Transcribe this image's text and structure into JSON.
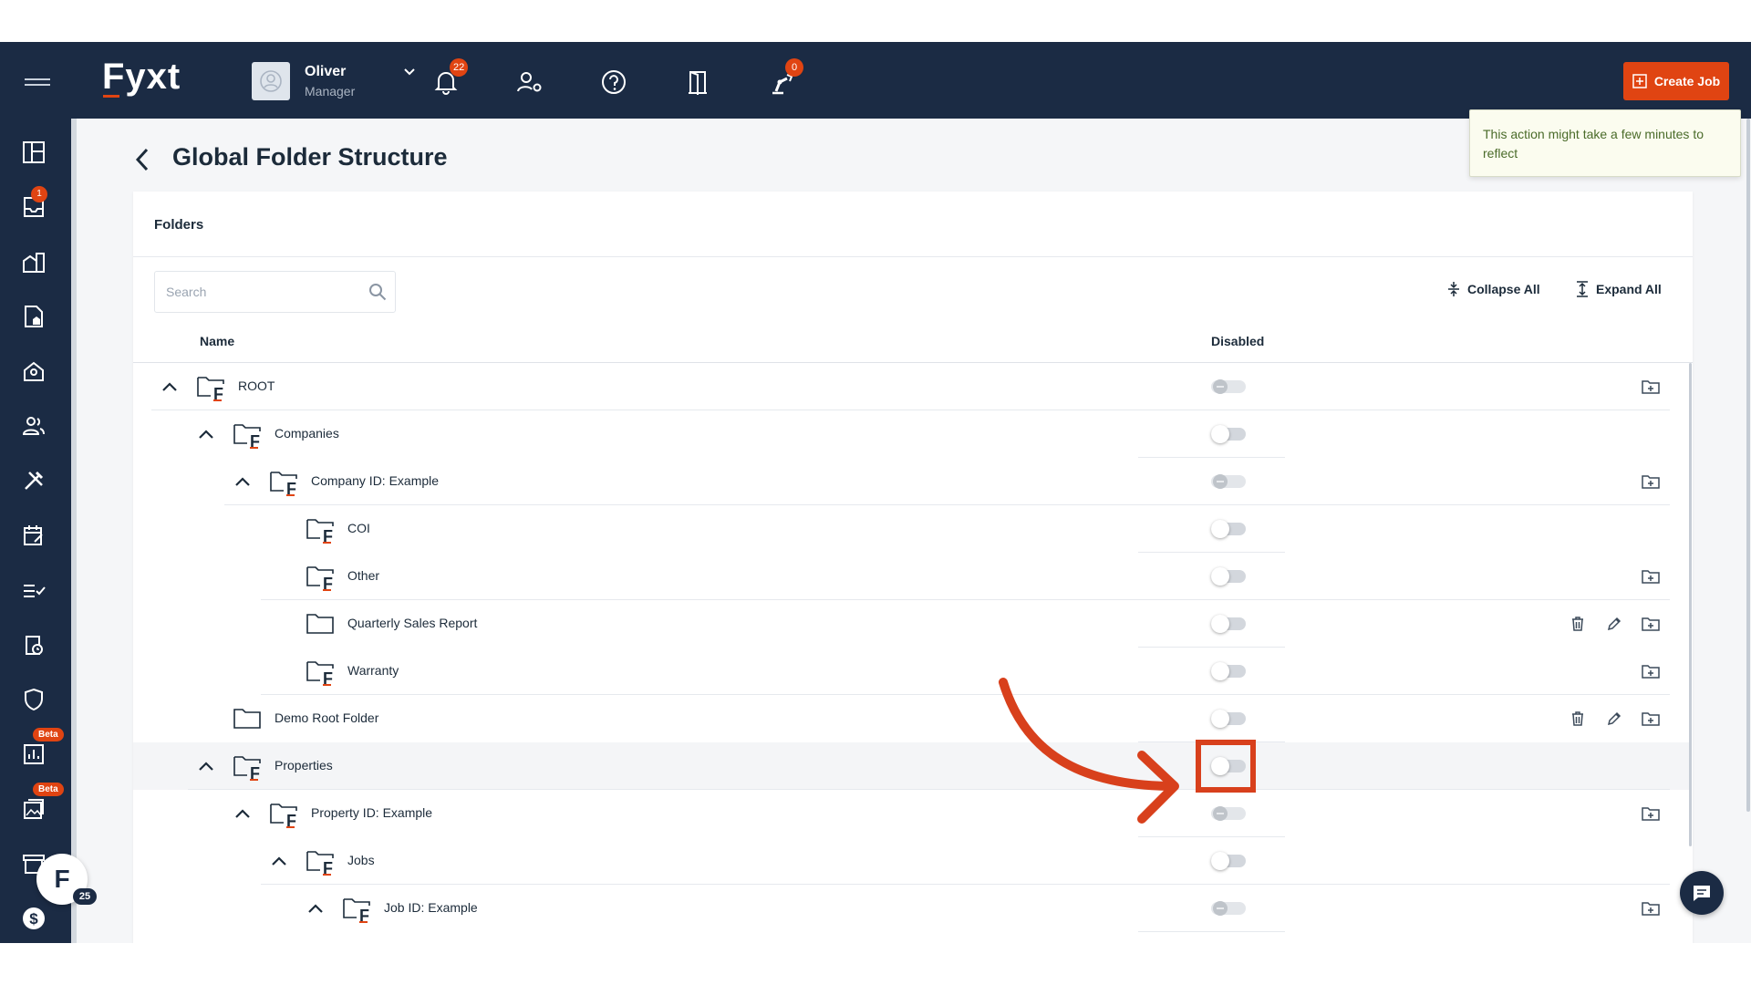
{
  "app": {
    "logo": "Fyxt",
    "user": {
      "name": "Oliver",
      "role": "Manager"
    },
    "notifications_count": "22",
    "robot_badge_count": "0",
    "create_job_label": "Create Job",
    "tooltip": "This action might take a few minutes to reflect",
    "colors": {
      "navy": "#1b2b44",
      "accent": "#e04412"
    }
  },
  "sidebar": {
    "inbox_badge": "1",
    "beta_label": "Beta",
    "fab_letter": "F",
    "fab_badge": "25",
    "icons": [
      "dashboard-icon",
      "inbox-icon",
      "properties-icon",
      "documents-icon",
      "tenants-icon",
      "contacts-icon",
      "tools-icon",
      "calendar-icon",
      "checklist-icon",
      "clipboard-clock-icon",
      "shield-icon",
      "reports-icon",
      "gallery-icon",
      "store-icon",
      "dollar-icon"
    ]
  },
  "page": {
    "title": "Global Folder Structure",
    "card_title": "Folders",
    "search_placeholder": "Search",
    "collapse_all": "Collapse All",
    "expand_all": "Expand All",
    "columns": {
      "name": "Name",
      "disabled": "Disabled"
    }
  },
  "rows": [
    {
      "label": "ROOT",
      "level": 0,
      "expanded": true,
      "fyxt": true,
      "toggle": "disabled",
      "actions": [
        "add"
      ]
    },
    {
      "label": "Companies",
      "level": 1,
      "expanded": true,
      "fyxt": true,
      "toggle": "off",
      "actions": []
    },
    {
      "label": "Company ID: Example",
      "level": 2,
      "expanded": true,
      "fyxt": true,
      "toggle": "disabled",
      "actions": [
        "add"
      ]
    },
    {
      "label": "COI",
      "level": 3,
      "expanded": null,
      "fyxt": true,
      "toggle": "off",
      "actions": []
    },
    {
      "label": "Other",
      "level": 3,
      "expanded": null,
      "fyxt": true,
      "toggle": "off",
      "actions": [
        "add"
      ]
    },
    {
      "label": "Quarterly Sales Report",
      "level": 3,
      "expanded": null,
      "fyxt": false,
      "toggle": "off",
      "actions": [
        "delete",
        "edit",
        "add"
      ]
    },
    {
      "label": "Warranty",
      "level": 3,
      "expanded": null,
      "fyxt": true,
      "toggle": "off",
      "actions": [
        "add"
      ]
    },
    {
      "label": "Demo Root Folder",
      "level": 1,
      "expanded": null,
      "fyxt": false,
      "toggle": "off",
      "actions": [
        "delete",
        "edit",
        "add"
      ]
    },
    {
      "label": "Properties",
      "level": 1,
      "expanded": true,
      "fyxt": true,
      "toggle": "off",
      "actions": [],
      "highlight": true
    },
    {
      "label": "Property ID: Example",
      "level": 2,
      "expanded": true,
      "fyxt": true,
      "toggle": "disabled",
      "actions": [
        "add"
      ]
    },
    {
      "label": "Jobs",
      "level": 3,
      "expanded": true,
      "fyxt": true,
      "toggle": "off",
      "actions": []
    },
    {
      "label": "Job ID: Example",
      "level": 4,
      "expanded": true,
      "fyxt": true,
      "toggle": "disabled",
      "actions": [
        "add"
      ]
    }
  ]
}
